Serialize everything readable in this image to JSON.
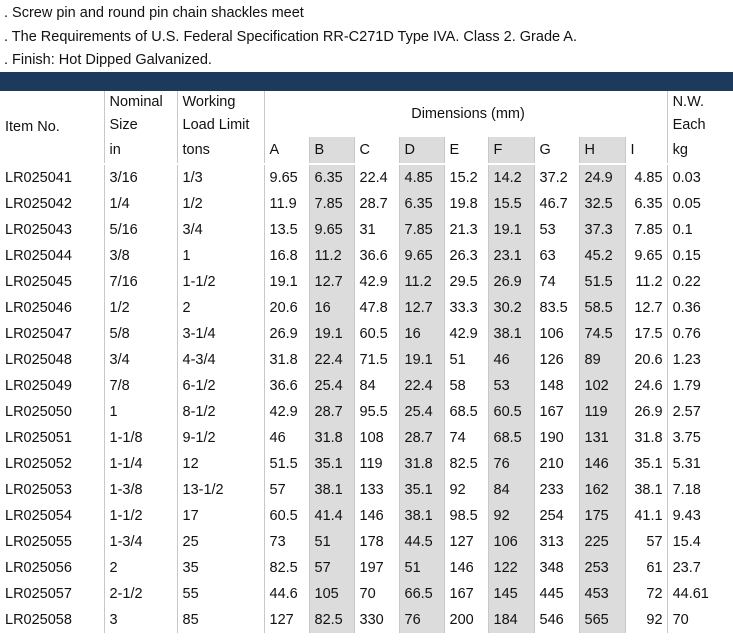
{
  "notes": [
    ". Screw pin and round pin chain shackles meet",
    ". The Requirements of U.S. Federal Specification RR-C271D Type IVA. Class 2. Grade A.",
    ".  Finish: Hot Dipped Galvanized."
  ],
  "header": {
    "item": "Item No.",
    "nominal_1": "Nominal",
    "nominal_2": "Size",
    "wll_1": "Working",
    "wll_2": "Load Limit",
    "dimensions": "Dimensions (mm)",
    "nw_1": "N.W.",
    "nw_2": "Each"
  },
  "units": {
    "size": "in",
    "wll": "tons",
    "nw": "kg"
  },
  "dim_letters": [
    "A",
    "B",
    "C",
    "D",
    "E",
    "F",
    "G",
    "H",
    "I"
  ],
  "rows": [
    [
      "LR025041",
      "3/16",
      "1/3",
      "9.65",
      "6.35",
      "22.4",
      "4.85",
      "15.2",
      "14.2",
      "37.2",
      "24.9",
      "4.85",
      "0.03"
    ],
    [
      "LR025042",
      "1/4",
      "1/2",
      "11.9",
      "7.85",
      "28.7",
      "6.35",
      "19.8",
      "15.5",
      "46.7",
      "32.5",
      "6.35",
      "0.05"
    ],
    [
      "LR025043",
      "5/16",
      "3/4",
      "13.5",
      "9.65",
      "31",
      "7.85",
      "21.3",
      "19.1",
      "53",
      "37.3",
      "7.85",
      "0.1"
    ],
    [
      "LR025044",
      "3/8",
      "1",
      "16.8",
      "11.2",
      "36.6",
      "9.65",
      "26.3",
      "23.1",
      "63",
      "45.2",
      "9.65",
      "0.15"
    ],
    [
      "LR025045",
      "7/16",
      "1-1/2",
      "19.1",
      "12.7",
      "42.9",
      "11.2",
      "29.5",
      "26.9",
      "74",
      "51.5",
      "11.2",
      "0.22"
    ],
    [
      "LR025046",
      "1/2",
      "2",
      "20.6",
      "16",
      "47.8",
      "12.7",
      "33.3",
      "30.2",
      "83.5",
      "58.5",
      "12.7",
      "0.36"
    ],
    [
      "LR025047",
      "5/8",
      "3-1/4",
      "26.9",
      "19.1",
      "60.5",
      "16",
      "42.9",
      "38.1",
      "106",
      "74.5",
      "17.5",
      "0.76"
    ],
    [
      "LR025048",
      "3/4",
      "4-3/4",
      "31.8",
      "22.4",
      "71.5",
      "19.1",
      "51",
      "46",
      "126",
      "89",
      "20.6",
      "1.23"
    ],
    [
      "LR025049",
      "7/8",
      "6-1/2",
      "36.6",
      "25.4",
      "84",
      "22.4",
      "58",
      "53",
      "148",
      "102",
      "24.6",
      "1.79"
    ],
    [
      "LR025050",
      "1",
      "8-1/2",
      "42.9",
      "28.7",
      "95.5",
      "25.4",
      "68.5",
      "60.5",
      "167",
      "119",
      "26.9",
      "2.57"
    ],
    [
      "LR025051",
      "1-1/8",
      "9-1/2",
      "46",
      "31.8",
      "108",
      "28.7",
      "74",
      "68.5",
      "190",
      "131",
      "31.8",
      "3.75"
    ],
    [
      "LR025052",
      "1-1/4",
      "12",
      "51.5",
      "35.1",
      "119",
      "31.8",
      "82.5",
      "76",
      "210",
      "146",
      "35.1",
      "5.31"
    ],
    [
      "LR025053",
      "1-3/8",
      "13-1/2",
      "57",
      "38.1",
      "133",
      "35.1",
      "92",
      "84",
      "233",
      "162",
      "38.1",
      "7.18"
    ],
    [
      "LR025054",
      "1-1/2",
      "17",
      "60.5",
      "41.4",
      "146",
      "38.1",
      "98.5",
      "92",
      "254",
      "175",
      "41.1",
      "9.43"
    ],
    [
      "LR025055",
      "1-3/4",
      "25",
      "73",
      "51",
      "178",
      "44.5",
      "127",
      "106",
      "313",
      "225",
      "57",
      "15.4"
    ],
    [
      "LR025056",
      "2",
      "35",
      "82.5",
      "57",
      "197",
      "51",
      "146",
      "122",
      "348",
      "253",
      "61",
      "23.7"
    ],
    [
      "LR025057",
      "2-1/2",
      "55",
      "44.6",
      "105",
      "70",
      "66.5",
      "167",
      "145",
      "445",
      "453",
      "72",
      "44.61"
    ],
    [
      "LR025058",
      "3",
      "85",
      "127",
      "82.5",
      "330",
      "76",
      "200",
      "184",
      "546",
      "565",
      "92",
      "70"
    ]
  ]
}
